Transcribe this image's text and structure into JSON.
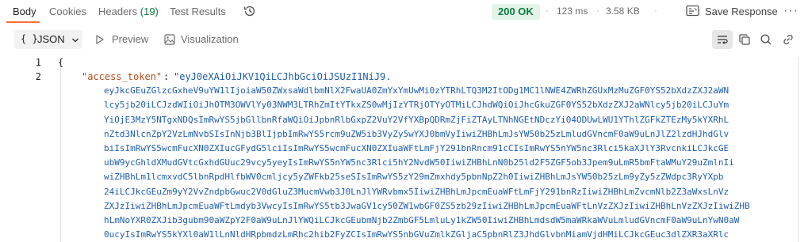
{
  "tabs": [
    {
      "label": "Body",
      "count": ""
    },
    {
      "label": "Cookies",
      "count": ""
    },
    {
      "label": "Headers",
      "count": "(19)"
    },
    {
      "label": "Test Results",
      "count": ""
    }
  ],
  "status": {
    "code": "200 OK",
    "time": "123 ms",
    "size": "3.58 KB",
    "separator": "·"
  },
  "save_response_label": "Save Response",
  "toolbar": {
    "format": "JSON",
    "braces": "{ }",
    "preview": "Preview",
    "visualization": "Visualization"
  },
  "colors": {
    "accent": "#ff6c37",
    "status_green": "#0f7b3f",
    "json_key": "#b44c1a",
    "json_string": "#1d5db1"
  },
  "icons": [
    "history-icon",
    "save-icon",
    "more-icon",
    "chevron-down-icon",
    "play-icon",
    "image-icon",
    "wrap-icon",
    "copy-icon",
    "search-icon",
    "link-icon"
  ],
  "editor": {
    "line_numbers": [
      "1",
      "2"
    ],
    "open_brace": "{",
    "key": "\"access_token\"",
    "colon": ":",
    "value_lines": [
      "\"eyJ0eXAiOiJKV1QiLCJhbGciOiJSUzI1NiJ9.",
      "eyJkcGEuZGlzcGxheV9uYW1lIjoiaW50ZWxsaWdlbmNlX2FwaUA0ZmYxYmUwMi0zYTRhLTQ3M2ItODg1MC1lNWE4ZWRhZGUxMzMuZGF0YS52bXdzZXJ2aWN",
      "lcy5jb20iLCJzdWIiOiJhOTM3OWVlYy03NWM3LTRhZmItYTkxZS0wMjIzYTRjOTYyOTMiLCJhdWQiOiJhcGkuZGF0YS52bXdzZXJ2aWNlcy5jb20iLCJuYm",
      "YiOjE3MzY5NTgxNDQsImRwYS5jbGllbnRfaWQiOiJpbnRlbGxpZ2VuY2VfYXBpQDRmZjFiZTAyLTNhNGEtNDczYi04ODUwLWU1YThlZGFkZTEzMy5kYXRhL",
      "nZtd3NlcnZpY2VzLmNvbSIsInNjb3BlIjpbImRwYS5rcm9uZW5ib3VyZy5wYXJ0bmVyIiwiZHBhLmJsYW50b25zLmludGVncmF0aW9uLnJlZ2lzdHJhdGlv",
      "biIsImRwYS5wcmFucXN0ZXIucGFydG5lciIsImRwYS5wcmFucXN0ZXIuaWFtLmFjY291bnRncm91cCIsImRwYS5nYW5nc3Rlci5kaXJlY3RvcnkiLCJkcGE",
      "ubW9ycGhldXMudGVtcGxhdGUuc29vcy5yeyIsImRwYS5nYW5nc3Rlci5hY2NvdW50IiwiZHBhLnN0b25ld2F5ZGF5ob3Jpem9uLmR5bmFtaWMuY29uZmlnIi",
      "wiZHBhLm1lcmxvdC5lbnRpdHlfbWV0cmljcy5yZWFkb25seSIsImRwYS5zY29mZmxhdy5pbnNpZ2h0IiwiZHBhLmJsYW50b25zLm9yZy5zZWdpc3RyYXpb",
      "24iLCJkcGEuZm9yY2VvZndpbGwuc2V0dGluZ3MucmVwb3J0LnJlYWRvbmx5IiwiZHBhLmJpcmEuaWFtLmFjY291bnRzIiwiZHBhLmZvcmNlb2Z3aWxsLnVz",
      "ZXJzIiwiZHBhLmJpcmEuaWFtLmdyb3VwcyIsImRwYS5tb3JwaGV1cy50ZW1wbGF0ZS5zb29zIiwiZHBhLmJpcmEuaWFtLnVzZXJzIiwiZHBhLnVzZXJzIiwiZHB",
      "hLmNoYXR0ZXJib3gubm90aWZpY2F0aW9uLnJlYWQiLCJkcGEubmNjb2ZmbGF5LmluLy1kZW50IiwiZHBhLmdsdW5maWRkaWVuLmludGVncmF0aW9uLnYwN0aW",
      "0ucyIsImRwYS5kYXl0aW1lLnNldHRpbmdzLmRhc2hib2FyZCIsImRwYS5nbGVuZmlkZGljaC5pbnRlZ3JhdGlvbnMiamVjdHMiLCJkcGEuc3dlZXR3aXRlc"
    ]
  }
}
